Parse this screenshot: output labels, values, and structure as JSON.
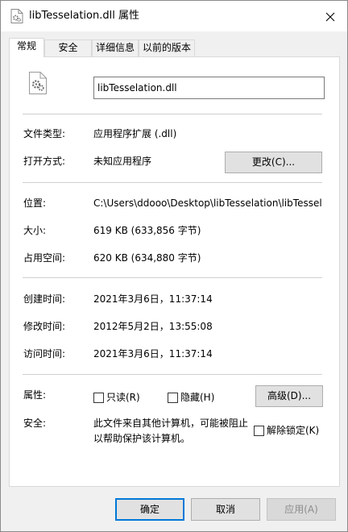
{
  "window": {
    "title": "libTesselation.dll 属性",
    "close_icon": "close-icon"
  },
  "tabs": [
    {
      "label": "常规",
      "active": true
    },
    {
      "label": "安全",
      "active": false
    },
    {
      "label": "详细信息",
      "active": false
    },
    {
      "label": "以前的版本",
      "active": false
    }
  ],
  "general": {
    "file_name": "libTesselation.dll",
    "file_type_label": "文件类型:",
    "file_type_value": "应用程序扩展 (.dll)",
    "opens_with_label": "打开方式:",
    "opens_with_value": "未知应用程序",
    "change_button": "更改(C)...",
    "location_label": "位置:",
    "location_value": "C:\\Users\\ddooo\\Desktop\\libTesselation\\libTessel",
    "size_label": "大小:",
    "size_value": "619 KB (633,856 字节)",
    "size_on_disk_label": "占用空间:",
    "size_on_disk_value": "620 KB (634,880 字节)",
    "created_label": "创建时间:",
    "created_value": "2021年3月6日，11:37:14",
    "modified_label": "修改时间:",
    "modified_value": "2012年5月2日，13:55:08",
    "accessed_label": "访问时间:",
    "accessed_value": "2021年3月6日，11:37:14",
    "attributes_label": "属性:",
    "readonly_label": "只读(R)",
    "hidden_label": "隐藏(H)",
    "advanced_button": "高级(D)...",
    "security_label": "安全:",
    "security_line1": "此文件来自其他计算机，可能被阻止",
    "security_line2": "以帮助保护该计算机。",
    "unblock_label": "解除锁定(K)"
  },
  "buttons": {
    "ok": "确定",
    "cancel": "取消",
    "apply": "应用(A)"
  }
}
